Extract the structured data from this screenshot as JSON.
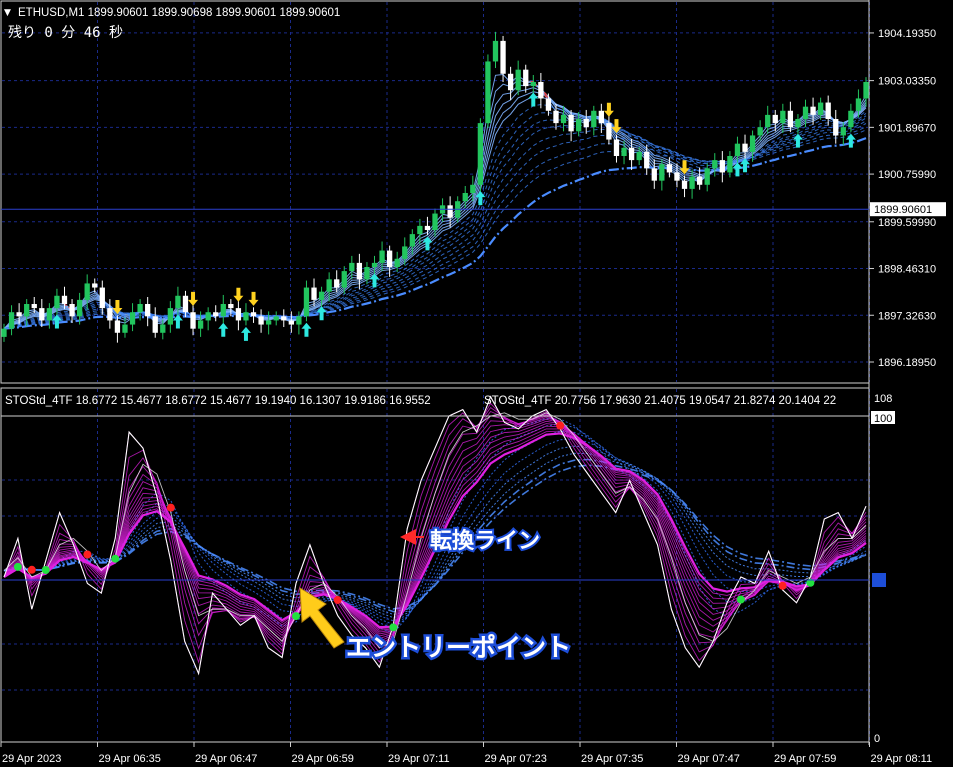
{
  "header": {
    "symbol_line": "ETHUSD,M1  1899.90601 1899.90698 1899.90601 1899.90601",
    "countdown": "残り  0 分 46 秒"
  },
  "indicator": {
    "label_1": "STOStd_4TF 18.6772 15.4677 18.6772 15.4677 19.1940 16.1307 19.9186 16.9552",
    "label_2": "STOStd_4TF 20.7756 17.9630 21.4075 19.0547 21.8274 20.1404 22",
    "scale_top": "108",
    "scale_marker": "100",
    "scale_bottom": "0"
  },
  "annotations": {
    "turn_line": "転換ライン",
    "entry_point": "エントリーポイント"
  },
  "colors": {
    "bull": "#22c55e",
    "bear": "#ffffff",
    "grid": "#1a2a8a",
    "ribbon_blue": "#3b82f6",
    "ribbon_red": "#ef4444",
    "arrow_up": "#2de8e0",
    "arrow_down": "#ffd21f",
    "stoch_magenta": "#e020e0",
    "annotation_text": "#ffffff",
    "annotation_outline": "#1d4ed8"
  },
  "chart_data": [
    {
      "type": "candlestick",
      "title": "ETHUSD,M1",
      "ylim": [
        1895.8,
        1904.8
      ],
      "price_ticks": [
        "1904.19350",
        "1903.03350",
        "1901.89670",
        "1900.75990",
        "1899.59990",
        "1898.46310",
        "1897.32630",
        "1896.18950"
      ],
      "current_price": "1899.90601",
      "time_labels": [
        "29 Apr 2023",
        "29 Apr 06:35",
        "29 Apr 06:47",
        "29 Apr 06:59",
        "29 Apr 07:11",
        "29 Apr 07:23",
        "29 Apr 07:35",
        "29 Apr 07:47",
        "29 Apr 07:59",
        "29 Apr 08:11"
      ],
      "close_series": [
        1897.0,
        1897.4,
        1897.3,
        1897.6,
        1897.5,
        1897.2,
        1897.5,
        1897.8,
        1897.6,
        1897.3,
        1897.7,
        1898.1,
        1898.0,
        1897.5,
        1897.2,
        1896.9,
        1897.1,
        1897.4,
        1897.6,
        1897.3,
        1896.9,
        1897.1,
        1897.5,
        1897.8,
        1897.4,
        1897.0,
        1897.2,
        1897.4,
        1897.3,
        1897.6,
        1897.5,
        1897.2,
        1897.4,
        1897.3,
        1897.1,
        1897.2,
        1897.3,
        1897.2,
        1897.1,
        1897.3,
        1898.0,
        1897.7,
        1897.9,
        1898.2,
        1898.0,
        1898.4,
        1898.6,
        1898.2,
        1898.5,
        1898.6,
        1898.9,
        1898.5,
        1898.7,
        1899.0,
        1899.3,
        1899.5,
        1899.4,
        1899.8,
        1900.0,
        1899.7,
        1900.1,
        1900.3,
        1900.5,
        1902.0,
        1903.5,
        1904.0,
        1903.2,
        1902.8,
        1903.3,
        1902.9,
        1903.0,
        1902.6,
        1902.3,
        1902.0,
        1902.2,
        1901.8,
        1902.1,
        1901.9,
        1902.3,
        1902.0,
        1901.6,
        1901.2,
        1901.4,
        1901.1,
        1901.3,
        1900.9,
        1900.6,
        1901.0,
        1900.8,
        1900.6,
        1900.4,
        1900.7,
        1900.5,
        1900.9,
        1901.1,
        1900.8,
        1901.2,
        1901.5,
        1901.3,
        1901.7,
        1901.9,
        1902.2,
        1902.0,
        1902.3,
        1901.9,
        1902.1,
        1902.4,
        1902.2,
        1902.5,
        1902.1,
        1901.7,
        1901.9,
        1902.3,
        1902.6,
        1903.0
      ]
    },
    {
      "type": "line",
      "title": "STOStd_4TF",
      "ylim": [
        0,
        108
      ],
      "k_series": [
        50,
        62,
        40,
        55,
        70,
        60,
        48,
        45,
        62,
        95,
        90,
        75,
        55,
        30,
        20,
        45,
        40,
        35,
        38,
        28,
        25,
        48,
        60,
        48,
        38,
        32,
        28,
        22,
        35,
        65,
        80,
        90,
        100,
        102,
        95,
        106,
        98,
        96,
        100,
        102,
        96,
        88,
        82,
        76,
        70,
        80,
        70,
        60,
        40,
        28,
        22,
        30,
        42,
        50,
        48,
        58,
        46,
        42,
        50,
        68,
        70,
        62,
        72
      ],
      "d_series": [
        52,
        56,
        50,
        52,
        60,
        62,
        58,
        52,
        56,
        76,
        85,
        82,
        70,
        52,
        38,
        40,
        40,
        38,
        38,
        34,
        30,
        38,
        46,
        48,
        44,
        38,
        34,
        28,
        30,
        45,
        62,
        76,
        88,
        95,
        97,
        100,
        101,
        99,
        99,
        101,
        99,
        94,
        88,
        82,
        76,
        78,
        74,
        68,
        56,
        42,
        32,
        30,
        34,
        42,
        46,
        52,
        50,
        48,
        50,
        58,
        62,
        62,
        66
      ]
    }
  ]
}
